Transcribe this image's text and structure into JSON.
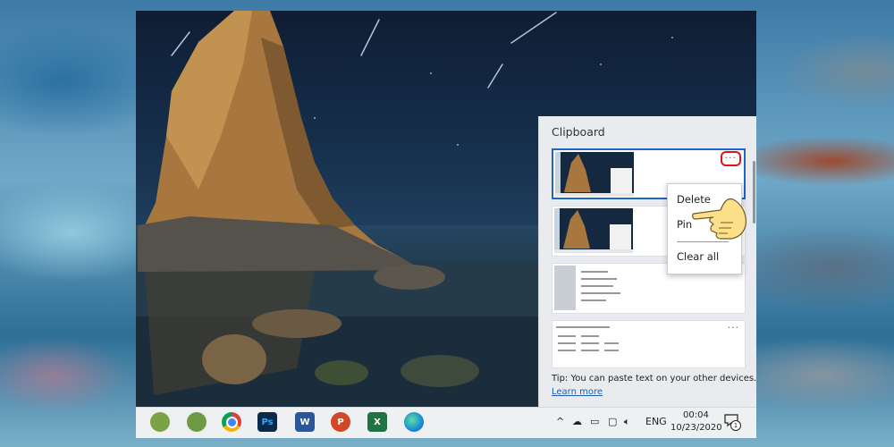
{
  "clipboard": {
    "title": "Clipboard",
    "more_glyph": "···",
    "items": [
      {
        "kind": "screenshot",
        "selected": true
      },
      {
        "kind": "screenshot",
        "selected": false
      },
      {
        "kind": "document",
        "selected": false
      },
      {
        "kind": "document",
        "selected": false
      }
    ],
    "context_menu": {
      "delete": "Delete",
      "pin": "Pin",
      "clear_all": "Clear all"
    },
    "tip": "Tip: You can paste text on your other devices.",
    "learn_more": "Learn more"
  },
  "taskbar": {
    "apps": [
      {
        "name": "app-1",
        "icon": "green-app-icon"
      },
      {
        "name": "app-2",
        "icon": "green-app-icon"
      },
      {
        "name": "chrome",
        "icon": "chrome-icon"
      },
      {
        "name": "photoshop",
        "label": "Ps",
        "color": "#0b2a4a"
      },
      {
        "name": "word",
        "label": "W",
        "color": "#2b579a"
      },
      {
        "name": "powerpoint",
        "label": "P",
        "color": "#d24726"
      },
      {
        "name": "excel",
        "label": "X",
        "color": "#217346"
      },
      {
        "name": "edge",
        "icon": "edge-icon"
      }
    ],
    "tray": {
      "chevron": "^",
      "language": "ENG",
      "time": "00:04",
      "date": "10/23/2020",
      "notification_count": "1"
    }
  },
  "colors": {
    "accent": "#1f64c8",
    "highlight": "#d21a1a"
  }
}
